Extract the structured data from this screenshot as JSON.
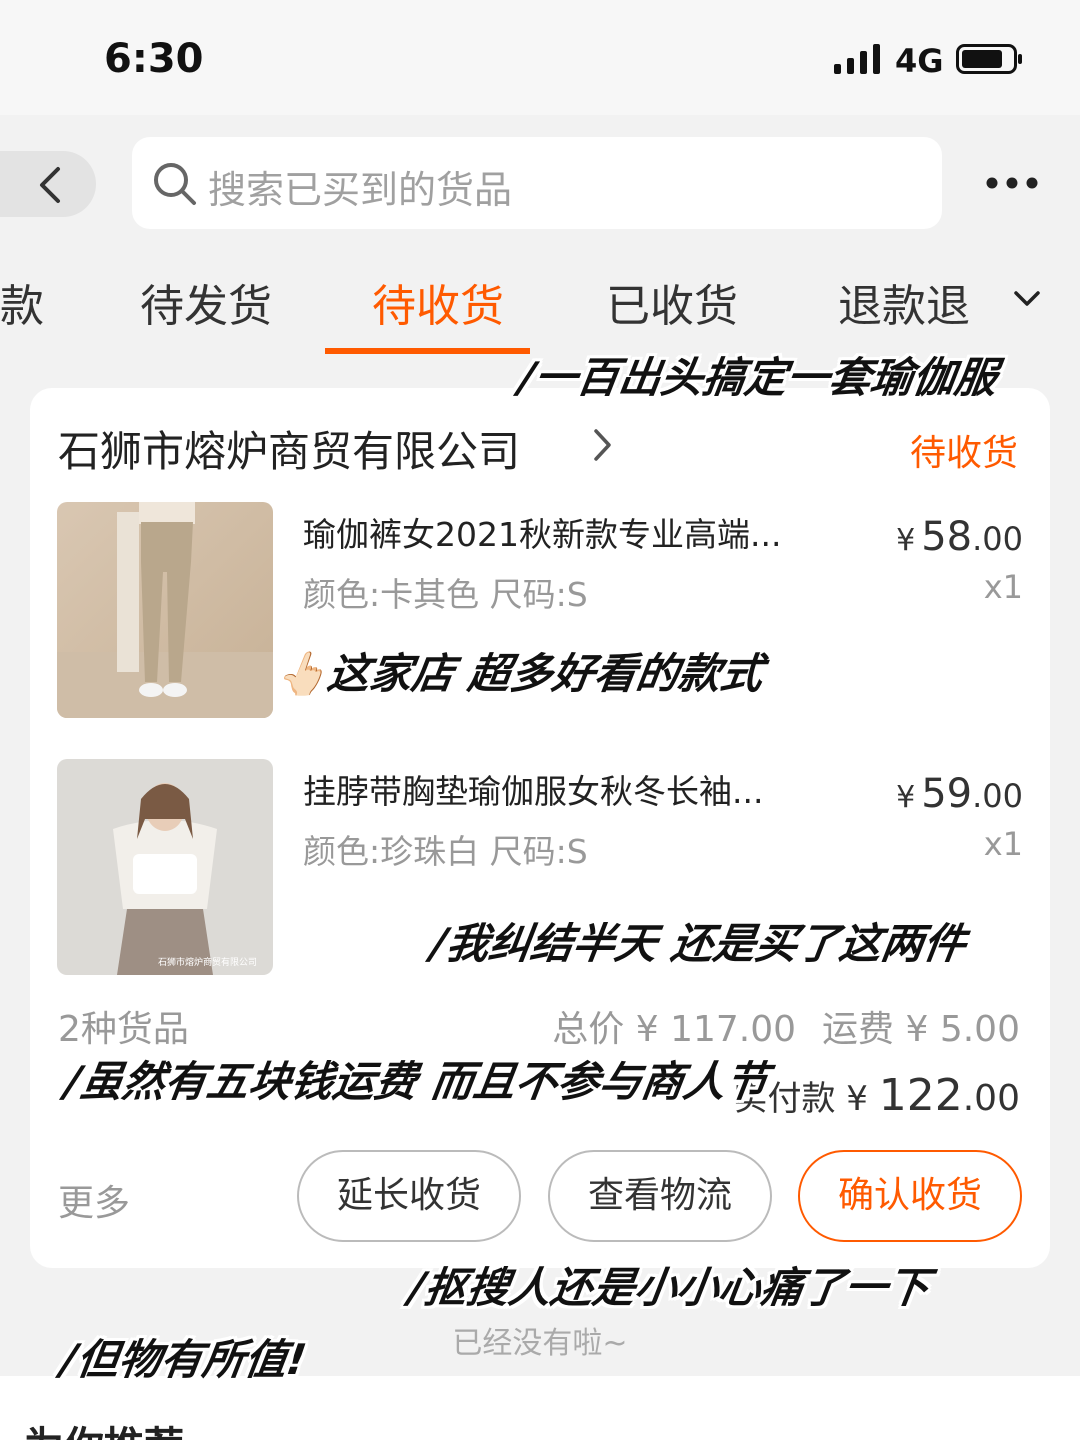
{
  "status_bar": {
    "time": "6:30",
    "network": "4G"
  },
  "header": {
    "search_placeholder": "搜索已买到的货品"
  },
  "tabs": [
    {
      "label": "款"
    },
    {
      "label": "待发货"
    },
    {
      "label": "待收货",
      "active": true
    },
    {
      "label": "已收货"
    },
    {
      "label": "退款退"
    }
  ],
  "order": {
    "shop_name": "石狮市熔炉商贸有限公司",
    "status": "待收货",
    "items": [
      {
        "title": "瑜伽裤女2021秋新款专业高端...",
        "spec": "颜色:卡其色 尺码:S",
        "price_currency": "¥",
        "price_int": "58",
        "price_dec": ".00",
        "qty": "x1"
      },
      {
        "title": "挂脖带胸垫瑜伽服女秋冬长袖...",
        "spec": "颜色:珍珠白 尺码:S",
        "price_currency": "¥",
        "price_int": "59",
        "price_dec": ".00",
        "qty": "x1",
        "image_watermark": "石狮市熔炉商贸有限公司"
      }
    ],
    "goods_count": "2种货品",
    "total_label": "总价 ¥ 117.00",
    "shipping_label": "运费 ¥ 5.00",
    "paid_label": "实付款 ¥",
    "paid_int": "122",
    "paid_dec": ".00",
    "more_label": "更多",
    "buttons": {
      "extend": "延长收货",
      "logistics": "查看物流",
      "confirm": "确认收货"
    }
  },
  "end_text": "已经没有啦~",
  "recommend_title": "为你推荐",
  "captions": {
    "c1": "/一百出头搞定一套瑜伽服",
    "c2": "👆🏻这家店 超多好看的款式",
    "c3": "/我纠结半天 还是买了这两件",
    "c4": "/虽然有五块钱运费 而且不参与商人节",
    "c5": "/抠搜人还是小小心痛了一下",
    "c6": "/但物有所值!"
  },
  "colors": {
    "accent": "#ff5a00",
    "background": "#f2f2f2"
  }
}
